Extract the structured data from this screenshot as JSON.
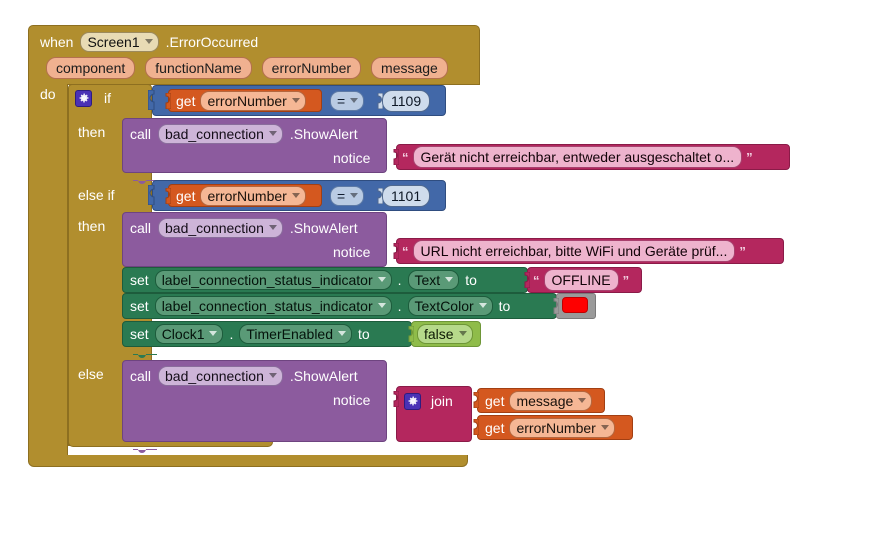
{
  "workspace": {
    "background_color": "#ffffff",
    "language": "App Inventor Blocks"
  },
  "event_block": {
    "color": "#b18e2e",
    "when_label": "when",
    "component": "Screen1",
    "event_name": ".ErrorOccurred",
    "parameters": [
      "component",
      "functionName",
      "errorNumber",
      "message"
    ],
    "do_label": "do"
  },
  "if_block": {
    "color": "#b18e2e",
    "gear_icon": "gear-icon",
    "if_label": "if",
    "then_label_1": "then",
    "else_if_label": "else if",
    "then_label_2": "then",
    "else_label": "else"
  },
  "condition_1": {
    "color": "#4268a8",
    "get_label": "get",
    "variable": "errorNumber",
    "operator": "=",
    "value": "1109"
  },
  "condition_2": {
    "color": "#4268a8",
    "get_label": "get",
    "variable": "errorNumber",
    "operator": "=",
    "value": "1101"
  },
  "then_1": {
    "call": {
      "color": "#8c5b9e",
      "call_label": "call",
      "component": "bad_connection",
      "method": ".ShowAlert",
      "arg_label": "notice"
    },
    "notice_text": {
      "color": "#b4275e",
      "value": "Gerät nicht erreichbar, entweder ausgeschaltet o..."
    }
  },
  "then_2": {
    "call": {
      "color": "#8c5b9e",
      "call_label": "call",
      "component": "bad_connection",
      "method": ".ShowAlert",
      "arg_label": "notice"
    },
    "notice_text": {
      "color": "#b4275e",
      "value": "URL nicht erreichbar, bitte WiFi und Geräte prüf..."
    },
    "setters": [
      {
        "color": "#2a7a52",
        "set_label": "set",
        "component": "label_connection_status_indicator",
        "dot": ".",
        "property": "Text",
        "to_label": "to",
        "value_kind": "text",
        "value": "OFFLINE"
      },
      {
        "color": "#2a7a52",
        "set_label": "set",
        "component": "label_connection_status_indicator",
        "dot": ".",
        "property": "TextColor",
        "to_label": "to",
        "value_kind": "color",
        "value": "#fe0000"
      },
      {
        "color": "#2a7a52",
        "set_label": "set",
        "component": "Clock1",
        "dot": ".",
        "property": "TimerEnabled",
        "to_label": "to",
        "value_kind": "boolean",
        "value": "false"
      }
    ]
  },
  "else_branch": {
    "call": {
      "color": "#8c5b9e",
      "call_label": "call",
      "component": "bad_connection",
      "method": ".ShowAlert",
      "arg_label": "notice"
    },
    "join": {
      "color": "#b4275e",
      "gear_icon": "gear-icon",
      "label": "join",
      "items": [
        {
          "get_label": "get",
          "variable": "message"
        },
        {
          "get_label": "get",
          "variable": "errorNumber"
        }
      ]
    }
  }
}
